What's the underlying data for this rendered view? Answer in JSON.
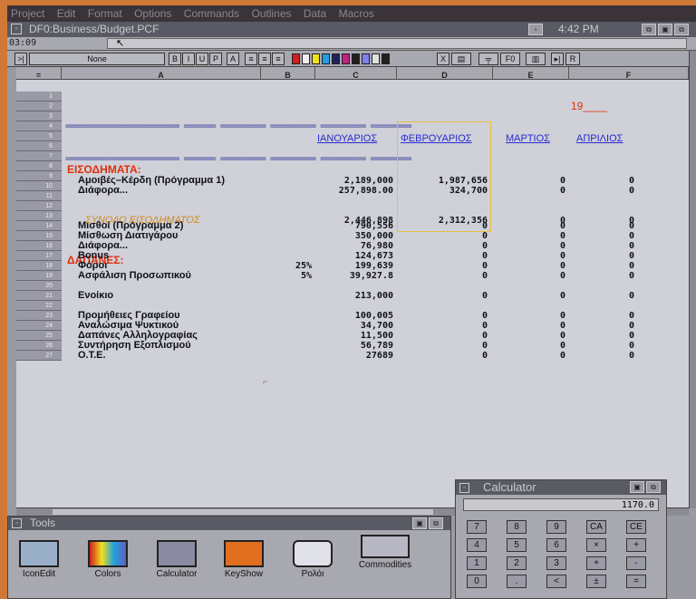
{
  "menu": [
    "Project",
    "Edit",
    "Format",
    "Options",
    "Commands",
    "Outlines",
    "Data",
    "Macros"
  ],
  "window": {
    "title": "DF0:Business/Budget.PCF",
    "time": "4:42 PM"
  },
  "cell_ref": "03:09",
  "toolbar": {
    "style": "None"
  },
  "columns": [
    "A",
    "B",
    "C",
    "D",
    "E",
    "F"
  ],
  "sheet": {
    "year": "19____",
    "headers": {
      "jan": "ΙΑΝΟΥΑΡΙΟΣ",
      "feb": "ΦΕΒΡΟΥΑΡΙΟΣ",
      "mar": "ΜΑΡΤΙΟΣ",
      "apr": "ΑΠΡΙΛΙΟΣ"
    },
    "income_title": "ΕΙΣΟΔΗΜΑΤΑ:",
    "income": [
      {
        "label": "Αμοιβές–Κέρδη (Πρόγραμμα 1)",
        "c": "2,189,000",
        "d": "1,987,656",
        "e": "0",
        "f": "0"
      },
      {
        "label": "Διάφορα...",
        "c": "257,898.00",
        "d": "324,700",
        "e": "0",
        "f": "0"
      }
    ],
    "income_total": {
      "label": "ΣΥΝΟΛΟ ΕΙΣΟΔΗΜΑΤΟΣ",
      "c": "2,446,898",
      "d": "2,312,356",
      "e": "0",
      "f": "0"
    },
    "expense_title": "ΔΑΠΑΝΕΣ:",
    "expenses": [
      {
        "row": 14,
        "label": "Μισθοί (Πρόγραμμα 2)",
        "b": "",
        "c": "790,556",
        "d": "0",
        "e": "0",
        "f": "0"
      },
      {
        "row": 15,
        "label": "Μίσθωση Διατιγάρου",
        "b": "",
        "c": "350,000",
        "d": "0",
        "e": "0",
        "f": "0"
      },
      {
        "row": 16,
        "label": "Διάφορα...",
        "b": "",
        "c": "76,980",
        "d": "0",
        "e": "0",
        "f": "0"
      },
      {
        "row": 17,
        "label": "Bonus",
        "b": "",
        "c": "124,673",
        "d": "0",
        "e": "0",
        "f": "0"
      },
      {
        "row": 18,
        "label": "Φόροι",
        "b": "25%",
        "c": "199,639",
        "d": "0",
        "e": "0",
        "f": "0"
      },
      {
        "row": 19,
        "label": "Ασφάλιση Προσωπικού",
        "b": "5%",
        "c": "39,927.8",
        "d": "0",
        "e": "0",
        "f": "0"
      },
      {
        "row": 21,
        "label": "Ενοίκιο",
        "b": "",
        "c": "213,000",
        "d": "0",
        "e": "0",
        "f": "0"
      },
      {
        "row": 23,
        "label": "Προμήθειες Γραφείου",
        "b": "",
        "c": "100,005",
        "d": "0",
        "e": "0",
        "f": "0"
      },
      {
        "row": 24,
        "label": "Αναλώσιμα Ψυκτικού",
        "b": "",
        "c": "34,700",
        "d": "0",
        "e": "0",
        "f": "0"
      },
      {
        "row": 25,
        "label": "Δαπάνες Αλληλογραφίας",
        "b": "",
        "c": "11,500",
        "d": "0",
        "e": "0",
        "f": "0"
      },
      {
        "row": 26,
        "label": "Συντήρηση Εξοπλισμού",
        "b": "",
        "c": "56,789",
        "d": "0",
        "e": "0",
        "f": "0"
      },
      {
        "row": 27,
        "label": "O.T.E.",
        "b": "",
        "c": "27689",
        "d": "0",
        "e": "0",
        "f": "0"
      }
    ]
  },
  "tools": {
    "title": "Tools",
    "items": [
      "IconEdit",
      "Colors",
      "Calculator",
      "KeyShow",
      "Ρολόι",
      "Commodities"
    ]
  },
  "calculator": {
    "title": "Calculator",
    "display": "1170.0",
    "keys": [
      "7",
      "8",
      "9",
      "CA",
      "CE",
      "4",
      "5",
      "6",
      "×",
      "+",
      "1",
      "2",
      "3",
      "+",
      "-",
      "0",
      ".",
      "<",
      "±",
      "="
    ]
  },
  "colors": {
    "highlight": "#e8c040",
    "header": "#2a2ad0",
    "red": "#e0300a",
    "orange": "#d8881a"
  }
}
